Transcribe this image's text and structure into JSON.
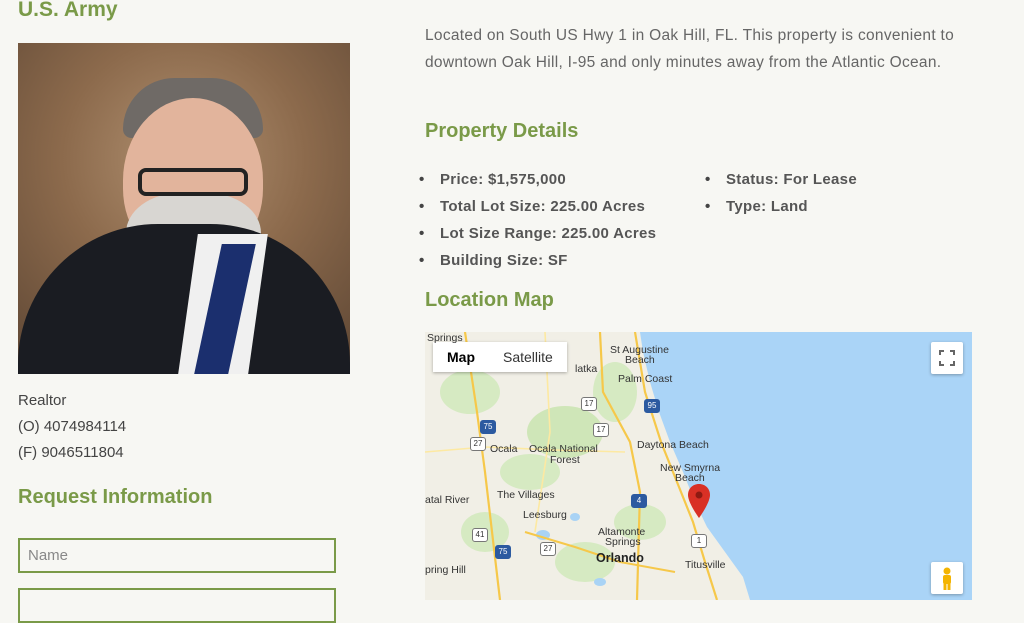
{
  "agent": {
    "affiliation": "U.S. Army",
    "role": "Realtor",
    "phone_office": "(O) 4074984114",
    "phone_fax": "(F) 9046511804"
  },
  "request": {
    "title": "Request Information",
    "name_placeholder": "Name"
  },
  "property": {
    "description": "Located on South US Hwy 1 in Oak Hill, FL. This property is convenient to downtown Oak Hill, I-95 and only minutes away from the Atlantic Ocean.",
    "details_title": "Property Details",
    "details_left": [
      "Price: $1,575,000",
      "Total Lot Size: 225.00 Acres",
      "Lot Size Range: 225.00 Acres",
      "Building Size: SF"
    ],
    "details_right": [
      "Status: For Lease",
      "Type: Land"
    ]
  },
  "map": {
    "title": "Location Map",
    "type_map": "Map",
    "type_satellite": "Satellite",
    "labels": {
      "springs": "Springs",
      "st_augustine": "St Augustine",
      "beach": "Beach",
      "palatka": "latka",
      "palm_coast": "Palm Coast",
      "ocala": "Ocala",
      "ocala_nf": "Ocala National",
      "forest": "Forest",
      "daytona": "Daytona Beach",
      "new_smyrna": "New Smyrna",
      "new_smyrna_2": "Beach",
      "the_villages": "The Villages",
      "crystal_river": "atal River",
      "leesburg": "Leesburg",
      "altamonte": "Altamonte",
      "altamonte_2": "Springs",
      "orlando": "Orlando",
      "titusville": "Titusville",
      "spring_hill": "pring Hill"
    },
    "shields": {
      "i75a": "75",
      "i75b": "75",
      "i95": "95",
      "i4": "4",
      "us17a": "17",
      "us17b": "17",
      "us27a": "27",
      "us27b": "27",
      "us41": "41",
      "us1": "1"
    }
  }
}
